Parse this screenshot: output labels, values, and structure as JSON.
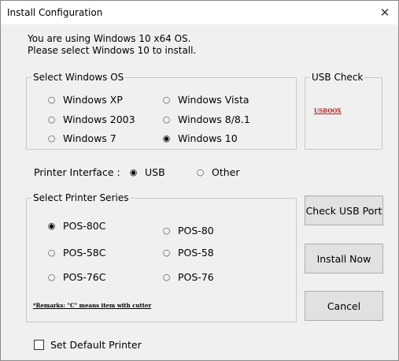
{
  "window": {
    "title": "Install Configuration",
    "close_glyph": "✕"
  },
  "intro": {
    "line1": "You are using Windows 10 x64 OS.",
    "line2": "Please select Windows 10 to install."
  },
  "os_group": {
    "legend": "Select Windows OS",
    "options": [
      "Windows XP",
      "Windows Vista",
      "Windows 2003",
      "Windows 8/8.1",
      "Windows 7",
      "Windows 10"
    ],
    "selected": "Windows 10"
  },
  "usb_check": {
    "legend": "USB Check",
    "status": "USBOOX"
  },
  "interface": {
    "label": "Printer Interface :",
    "options": [
      "USB",
      "Other"
    ],
    "selected": "USB"
  },
  "printer_group": {
    "legend": "Select Printer Series",
    "options": [
      "POS-80C",
      "POS-80",
      "POS-58C",
      "POS-58",
      "POS-76C",
      "POS-76"
    ],
    "selected": "POS-80C",
    "remark": "*Remarks: \"C\" means item with cutter"
  },
  "buttons": {
    "check_usb": "Check USB Port",
    "install": "Install Now",
    "cancel": "Cancel"
  },
  "default_printer": {
    "label": "Set Default Printer",
    "checked": false
  },
  "radio_glyphs": {
    "on": "◉",
    "off": "○"
  }
}
